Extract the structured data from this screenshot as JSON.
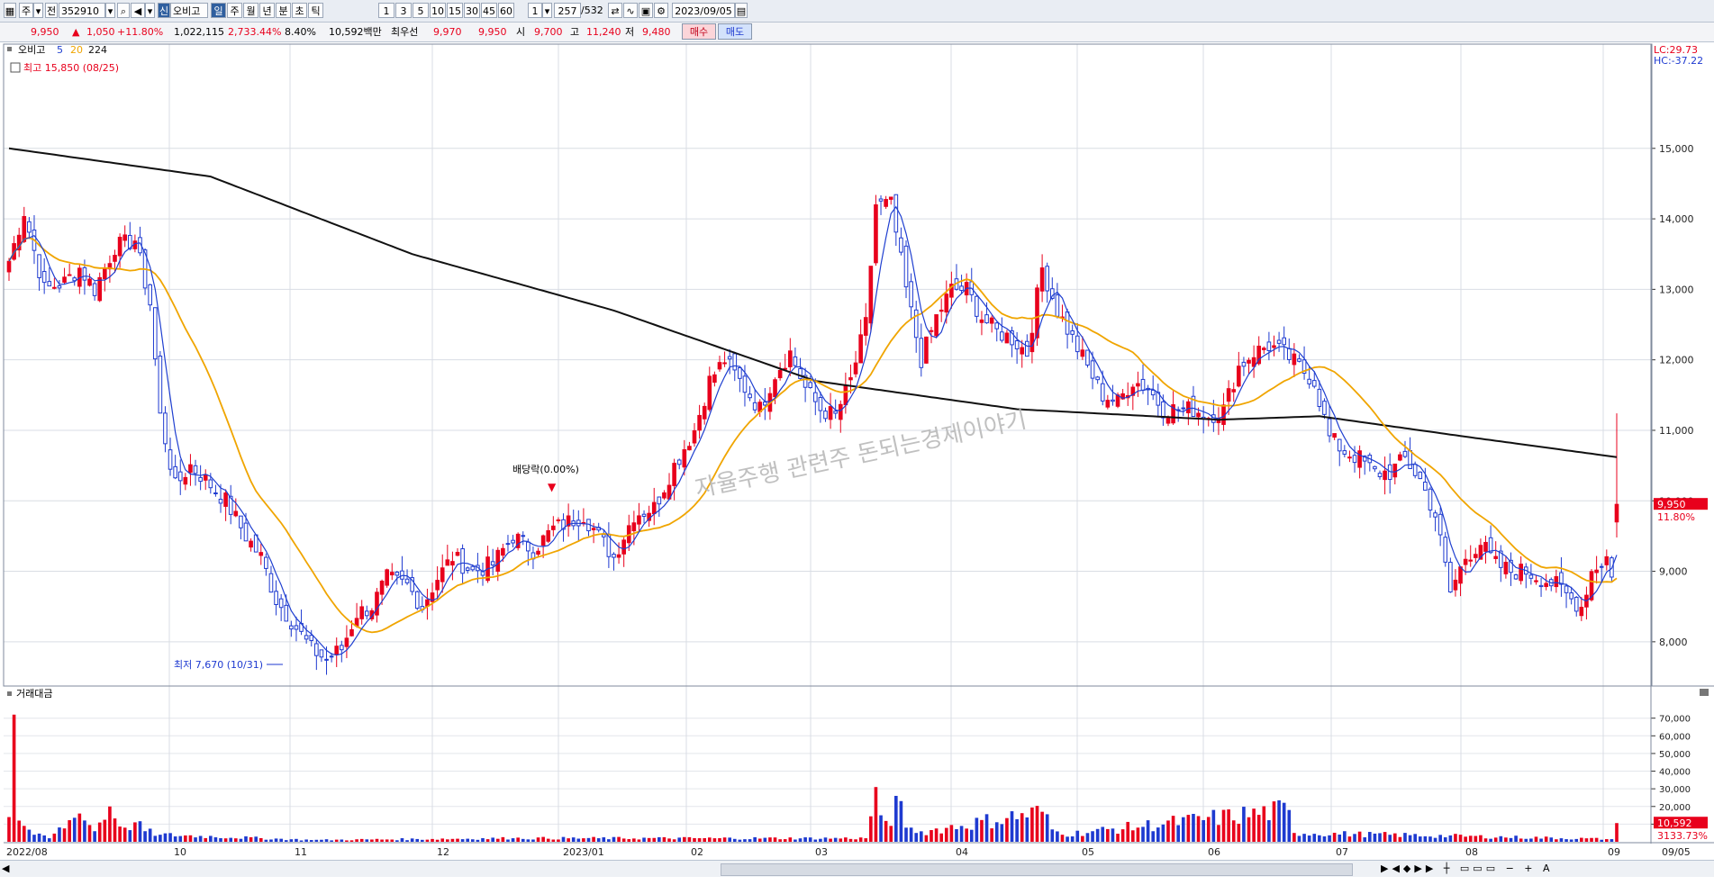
{
  "toolbar": {
    "market": "주",
    "code": "352910",
    "badge": "신",
    "name": "오비고",
    "periods": [
      "일",
      "주",
      "월",
      "년",
      "분",
      "초",
      "틱"
    ],
    "active_period": "일",
    "intervals": [
      "1",
      "3",
      "5",
      "10",
      "15",
      "30",
      "45",
      "60"
    ],
    "unit": "1",
    "count": "257",
    "total": "/532",
    "date": "2023/09/05"
  },
  "quote": {
    "price": "9,950",
    "change_arrow": "▲",
    "change": "1,050",
    "change_pct": "+11.80%",
    "volume": "1,022,115",
    "vol_ratio": "2,733.44%",
    "turnover": "8.40%",
    "amount": "10,592백만",
    "best_ask_label": "최우선",
    "best_ask": "9,970",
    "best_bid": "9,950",
    "open_label": "시",
    "open": "9,700",
    "high_label": "고",
    "high": "11,240",
    "low_label": "저",
    "low": "9,480",
    "buy": "매수",
    "sell": "매도"
  },
  "legend": {
    "name": "오비고",
    "ma5": "5",
    "ma20": "20",
    "ma224": "224",
    "high_note": "최고 15,850 (08/25)",
    "low_note": "최저 7,670 (10/31)",
    "dividend": "배당락(0.00%)",
    "lc": "LC:29.73",
    "hc": "HC:-37.22",
    "watermark": "자율주행 관련주 돈되는경제이야기",
    "last_price": "9,950",
    "last_pct": "11.80%",
    "vol_title": "거래대금",
    "vol_last": "10,592",
    "vol_pct": "3133.73%"
  },
  "chart_data": {
    "type": "candlestick",
    "y_ticks": [
      "15,000",
      "14,000",
      "13,000",
      "12,000",
      "11,000",
      "10,000",
      "9,000",
      "8,000"
    ],
    "ylim": [
      7500,
      16300
    ],
    "vol_ticks": [
      "70,000",
      "60,000",
      "50,000",
      "40,000",
      "30,000",
      "20,000",
      "10,000"
    ],
    "vol_ylim": [
      0,
      78000
    ],
    "x_labels": [
      "2022/08",
      "10",
      "11",
      "12",
      "2023/01",
      "02",
      "03",
      "04",
      "05",
      "06",
      "07",
      "08",
      "09",
      "09/05"
    ],
    "ma_colors": {
      "ma5": "#1f3fd0",
      "ma20": "#f0a500",
      "ma224": "#111111"
    },
    "up_color": "#e8001c",
    "down_color": "#1e3ad0",
    "close_anchors": [
      [
        0,
        13400
      ],
      [
        3,
        14100
      ],
      [
        7,
        13000
      ],
      [
        11,
        13100
      ],
      [
        14,
        13300
      ],
      [
        17,
        13000
      ],
      [
        21,
        13600
      ],
      [
        25,
        13700
      ],
      [
        28,
        12800
      ],
      [
        30,
        11200
      ],
      [
        33,
        10200
      ],
      [
        36,
        10500
      ],
      [
        39,
        10300
      ],
      [
        43,
        10000
      ],
      [
        47,
        9500
      ],
      [
        50,
        9200
      ],
      [
        53,
        8600
      ],
      [
        56,
        8300
      ],
      [
        60,
        7900
      ],
      [
        63,
        7750
      ],
      [
        66,
        7900
      ],
      [
        69,
        8400
      ],
      [
        72,
        8500
      ],
      [
        75,
        8900
      ],
      [
        79,
        8800
      ],
      [
        82,
        8500
      ],
      [
        85,
        8900
      ],
      [
        88,
        9200
      ],
      [
        92,
        9000
      ],
      [
        96,
        9100
      ],
      [
        100,
        9500
      ],
      [
        104,
        9300
      ],
      [
        108,
        9600
      ],
      [
        111,
        9700
      ],
      [
        114,
        9800
      ],
      [
        117,
        9500
      ],
      [
        120,
        9200
      ],
      [
        124,
        9800
      ],
      [
        128,
        9900
      ],
      [
        132,
        10500
      ],
      [
        136,
        11000
      ],
      [
        139,
        11700
      ],
      [
        142,
        12000
      ],
      [
        146,
        11600
      ],
      [
        149,
        11300
      ],
      [
        152,
        11800
      ],
      [
        155,
        12100
      ],
      [
        158,
        11600
      ],
      [
        161,
        11300
      ],
      [
        164,
        11200
      ],
      [
        167,
        11700
      ],
      [
        170,
        12500
      ],
      [
        172,
        14200
      ],
      [
        175,
        14200
      ],
      [
        178,
        13000
      ],
      [
        181,
        12000
      ],
      [
        184,
        12600
      ],
      [
        187,
        13000
      ],
      [
        190,
        13000
      ],
      [
        193,
        12600
      ],
      [
        196,
        12400
      ],
      [
        199,
        12300
      ],
      [
        202,
        12100
      ],
      [
        205,
        13300
      ],
      [
        208,
        12700
      ],
      [
        211,
        12300
      ],
      [
        214,
        11900
      ],
      [
        217,
        11500
      ],
      [
        220,
        11400
      ],
      [
        223,
        11700
      ],
      [
        226,
        11600
      ],
      [
        229,
        11300
      ],
      [
        232,
        11300
      ],
      [
        235,
        11300
      ],
      [
        238,
        11200
      ],
      [
        241,
        11300
      ],
      [
        244,
        11900
      ],
      [
        247,
        12100
      ],
      [
        250,
        12200
      ],
      [
        253,
        12100
      ],
      [
        256,
        11900
      ],
      [
        259,
        11700
      ],
      [
        262,
        10900
      ],
      [
        265,
        10700
      ],
      [
        268,
        10600
      ],
      [
        271,
        10400
      ],
      [
        274,
        10400
      ],
      [
        277,
        10600
      ],
      [
        280,
        10300
      ],
      [
        283,
        9800
      ],
      [
        286,
        8700
      ],
      [
        289,
        9200
      ],
      [
        292,
        9400
      ],
      [
        295,
        9100
      ],
      [
        298,
        9000
      ],
      [
        301,
        9000
      ],
      [
        304,
        8900
      ],
      [
        307,
        8800
      ],
      [
        310,
        8600
      ],
      [
        312,
        8500
      ],
      [
        314,
        9000
      ],
      [
        317,
        9200
      ],
      [
        318,
        8900
      ],
      [
        319,
        9950
      ]
    ],
    "volume_anchors": [
      [
        0,
        14000
      ],
      [
        1,
        72000
      ],
      [
        2,
        12000
      ],
      [
        3,
        9000
      ],
      [
        5,
        4000
      ],
      [
        8,
        2000
      ],
      [
        14,
        16000
      ],
      [
        17,
        6000
      ],
      [
        20,
        20000
      ],
      [
        23,
        8000
      ],
      [
        25,
        11000
      ],
      [
        27,
        6000
      ],
      [
        30,
        4000
      ],
      [
        60,
        1000
      ],
      [
        100,
        2000
      ],
      [
        140,
        2000
      ],
      [
        170,
        2000
      ],
      [
        172,
        31000
      ],
      [
        173,
        15000
      ],
      [
        175,
        9000
      ],
      [
        176,
        26000
      ],
      [
        178,
        8000
      ],
      [
        180,
        5000
      ],
      [
        205,
        17000
      ],
      [
        207,
        7000
      ],
      [
        209,
        4000
      ],
      [
        254,
        18000
      ],
      [
        255,
        5000
      ],
      [
        318,
        1500
      ],
      [
        319,
        10592
      ]
    ]
  }
}
